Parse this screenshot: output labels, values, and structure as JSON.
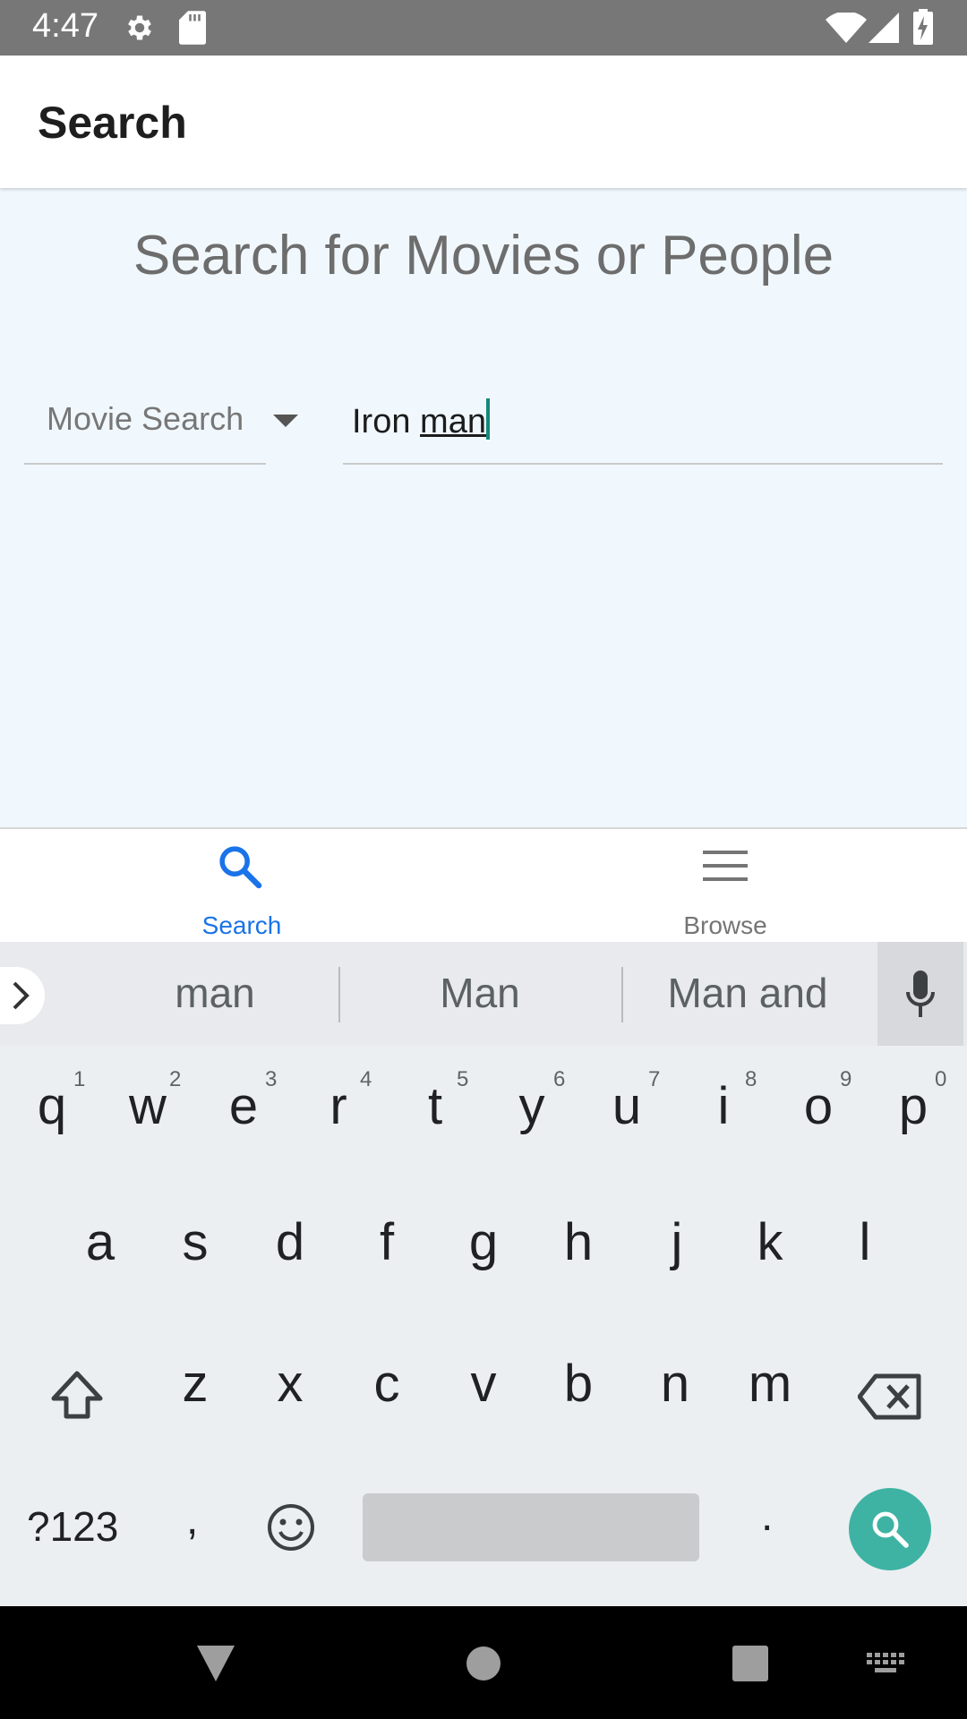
{
  "status_bar": {
    "time": "4:47",
    "icons": [
      "settings-icon",
      "sd-card-icon",
      "wifi-icon",
      "signal-icon",
      "battery-charging-icon"
    ]
  },
  "app_bar": {
    "title": "Search"
  },
  "main": {
    "heading": "Search for Movies or People",
    "search_type": {
      "selected": "Movie Search"
    },
    "query": {
      "value_plain": "Iron ",
      "value_underlined": "man"
    }
  },
  "bottom_nav": {
    "items": [
      {
        "label": "Search",
        "icon": "search-icon",
        "active": true
      },
      {
        "label": "Browse",
        "icon": "menu-icon",
        "active": false
      }
    ],
    "active_color": "#1a73e8",
    "inactive_color": "#757575"
  },
  "keyboard": {
    "suggestions": [
      "man",
      "Man",
      "Man and"
    ],
    "row1": [
      {
        "k": "q",
        "n": "1"
      },
      {
        "k": "w",
        "n": "2"
      },
      {
        "k": "e",
        "n": "3"
      },
      {
        "k": "r",
        "n": "4"
      },
      {
        "k": "t",
        "n": "5"
      },
      {
        "k": "y",
        "n": "6"
      },
      {
        "k": "u",
        "n": "7"
      },
      {
        "k": "i",
        "n": "8"
      },
      {
        "k": "o",
        "n": "9"
      },
      {
        "k": "p",
        "n": "0"
      }
    ],
    "row2": [
      "a",
      "s",
      "d",
      "f",
      "g",
      "h",
      "j",
      "k",
      "l"
    ],
    "row3": [
      "z",
      "x",
      "c",
      "v",
      "b",
      "n",
      "m"
    ],
    "symbols_label": "?123",
    "comma": ",",
    "period": ".",
    "accent_color": "#3eb3a4"
  }
}
